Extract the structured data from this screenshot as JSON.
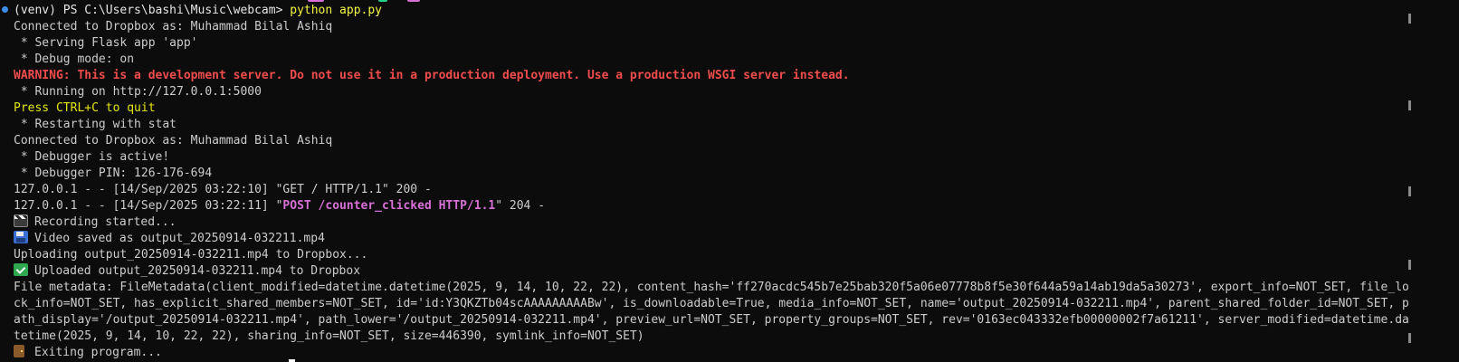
{
  "terminal": {
    "lines": [
      {
        "text": "(venv) PS C:\\Users\\bashi\\Music\\webcam> ",
        "cmd": "python app.py"
      },
      {
        "text": "Connected to Dropbox as: Muhammad Bilal Ashiq"
      },
      {
        "text": " * Serving Flask app 'app'"
      },
      {
        "text": " * Debug mode: on"
      },
      {
        "text": "WARNING: This is a development server. Do not use it in a production deployment. Use a production WSGI server instead."
      },
      {
        "text": " * Running on http://127.0.0.1:5000"
      },
      {
        "text": "Press CTRL+C to quit"
      },
      {
        "text": " * Restarting with stat"
      },
      {
        "text": "Connected to Dropbox as: Muhammad Bilal Ashiq"
      },
      {
        "text": " * Debugger is active!"
      },
      {
        "text": " * Debugger PIN: 126-176-694"
      },
      {
        "text": "127.0.0.1 - - [14/Sep/2025 03:22:10] \"GET / HTTP/1.1\" 200 -"
      },
      {
        "pre": "127.0.0.1 - - [14/Sep/2025 03:22:11] \"",
        "hl": "POST /counter_clicked HTTP/1.1",
        "post": "\" 204 -"
      },
      {
        "icon": "clapper-board-icon",
        "text": "Recording started..."
      },
      {
        "icon": "floppy-disk-icon",
        "text": "Video saved as output_20250914-032211.mp4"
      },
      {
        "text": "Uploading output_20250914-032211.mp4 to Dropbox..."
      },
      {
        "icon": "check-mark-icon",
        "text": "Uploaded output_20250914-032211.mp4 to Dropbox"
      },
      {
        "text": "File metadata: FileMetadata(client_modified=datetime.datetime(2025, 9, 14, 10, 22, 22), content_hash='ff270acdc545b7e25bab320f5a06e07778b8f5e30f644a59a14ab19da5a30273', export_info=NOT_SET, file_lo"
      },
      {
        "text": "ck_info=NOT_SET, has_explicit_shared_members=NOT_SET, id='id:Y3QKZTb04scAAAAAAAAABw', is_downloadable=True, media_info=NOT_SET, name='output_20250914-032211.mp4', parent_shared_folder_id=NOT_SET, p"
      },
      {
        "text": "ath_display='/output_20250914-032211.mp4', path_lower='/output_20250914-032211.mp4', preview_url=NOT_SET, property_groups=NOT_SET, rev='0163ec043332efb00000002f7a61211', server_modified=datetime.da"
      },
      {
        "text": "tetime(2025, 9, 14, 10, 22, 22), sharing_info=NOT_SET, size=446390, symlink_info=NOT_SET)"
      },
      {
        "icon": "door-icon",
        "text": "Exiting program..."
      }
    ]
  },
  "colors": {
    "background": "#0c0c0c",
    "foreground": "#cccccc",
    "command": "#f5f543",
    "warning": "#f14c4c",
    "highlight": "#d670d6",
    "prompt_dot": "#3b8eea"
  }
}
